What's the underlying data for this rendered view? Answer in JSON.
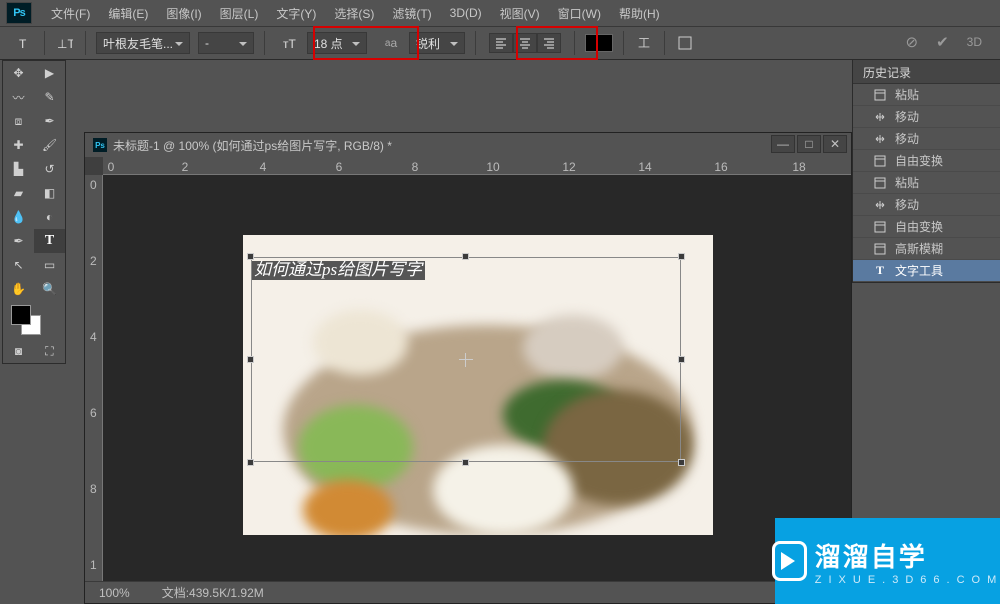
{
  "menu": {
    "file": "文件(F)",
    "edit": "编辑(E)",
    "image": "图像(I)",
    "layer": "图层(L)",
    "text": "文字(Y)",
    "select": "选择(S)",
    "filter": "滤镜(T)",
    "threeD": "3D(D)",
    "view": "视图(V)",
    "window": "窗口(W)",
    "help": "帮助(H)"
  },
  "opt": {
    "fontFamily": "叶根友毛笔...",
    "fontStyle": "-",
    "fontSize": "18 点",
    "aa": "锐利",
    "threeD": "3D"
  },
  "doc": {
    "title": "未标题-1 @ 100% (如何通过ps给图片写字, RGB/8) *",
    "textLayer": "如何通过ps给图片写字",
    "zoom": "100%",
    "fileinfo": "文档:439.5K/1.92M",
    "hticks": [
      "0",
      "2",
      "4",
      "6",
      "8",
      "10",
      "12",
      "14",
      "16",
      "18"
    ],
    "vticks": [
      "0",
      "2",
      "4",
      "6",
      "8",
      "1"
    ]
  },
  "history": {
    "title": "历史记录",
    "items": [
      {
        "icon": "paste",
        "label": "粘贴"
      },
      {
        "icon": "move",
        "label": "移动"
      },
      {
        "icon": "move",
        "label": "移动"
      },
      {
        "icon": "trans",
        "label": "自由变换"
      },
      {
        "icon": "paste",
        "label": "粘贴"
      },
      {
        "icon": "move",
        "label": "移动"
      },
      {
        "icon": "trans",
        "label": "自由变换"
      },
      {
        "icon": "blur",
        "label": "高斯模糊"
      },
      {
        "icon": "text",
        "label": "文字工具"
      }
    ]
  },
  "watermark": {
    "brand": "溜溜自学",
    "sub": "ZIXUE.3D66.COM"
  }
}
